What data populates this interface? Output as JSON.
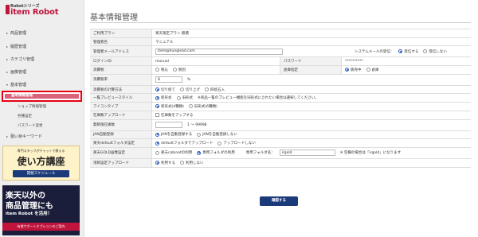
{
  "sidebar": {
    "logo_small": "Robotシリーズ",
    "logo_main": "item Robot",
    "items": [
      {
        "label": "商品管理"
      },
      {
        "label": "履歴管理"
      },
      {
        "label": "カテゴリ管理"
      },
      {
        "label": "画像管理"
      },
      {
        "label": "基本管理"
      }
    ],
    "active_sub": "基本情報管理",
    "subs": [
      "ショップ情報管理",
      "各種設定",
      "パスワード変更"
    ],
    "keyword_item": "狙い目キーワード",
    "banner1": {
      "top": "専門スタッフがチャットで教える",
      "main": "使い方講座",
      "button": "開催スケジュール"
    },
    "banner2": {
      "line1": "楽天以外の",
      "line2": "商品管理にも",
      "line3": "item Robot を活用！",
      "line4": "有償サポートオプションのご案内"
    }
  },
  "main": {
    "title": "基本情報管理",
    "rows": {
      "plan": {
        "label": "ご利用プラン",
        "value": "楽天限定プラン 無償"
      },
      "admin_name": {
        "label": "管理者名",
        "value": "マニュアル"
      },
      "admin_email": {
        "label": "管理者メールアドレス",
        "value": "item@hunglead.com",
        "sys_label": "システムメールの受信：",
        "opt_on": "受信する",
        "opt_off": "受信しない"
      },
      "login": {
        "label": "ログインID",
        "value": "manual",
        "pw_label": "パスワード",
        "pw_value": "**********"
      },
      "tax": {
        "label": "消費税",
        "opt1": "税込",
        "opt2": "税別",
        "stock_label": "倉庫指定",
        "stock_opt1": "販売中",
        "stock_opt2": "倉庫"
      },
      "tax_rate": {
        "label": "消費税率",
        "value": "8",
        "unit": "%"
      },
      "calc": {
        "label": "消費税の計算方法",
        "opt1": "切り捨て",
        "opt2": "切り上げ",
        "opt3": "四捨五入"
      },
      "preview": {
        "label": "一覧プレビュースタイル",
        "opt1": "新形式",
        "opt2": "旧形式",
        "note": "※商品一覧のプレビュー機能を旧形式にされたい場合は選択してください。"
      },
      "icon": {
        "label": "アイコンタイプ",
        "opt1": "新形式(4種類)",
        "opt2": "旧形式(6種類)"
      },
      "stock_upload": {
        "label": "在庫数アップロード",
        "check": "在庫数をアップする"
      },
      "unlimited": {
        "label": "無制限在庫数",
        "range": "1 〜 99998"
      },
      "jan": {
        "label": "JAN自動登録",
        "opt1": "JANを自動登録する",
        "opt2": "JANを自動登録しない"
      },
      "folder": {
        "label": "楽天defaultフォルダ設定",
        "opt1": "defaultフォルダでアップロード",
        "opt2": "アップロードしない"
      },
      "gold": {
        "label": "楽天GOLD画像設定",
        "opt1": "楽天cabinetの利用",
        "opt2": "専用フォルダの利用",
        "folder_label": "専用フォルダ名：",
        "folder_value": "irgold",
        "note": "※ 空欄の場合は「irgold」になります"
      },
      "item_upload": {
        "label": "項目設定アップロード",
        "opt1": "利用する",
        "opt2": "利用しない"
      }
    },
    "confirm_button": "確認する"
  }
}
